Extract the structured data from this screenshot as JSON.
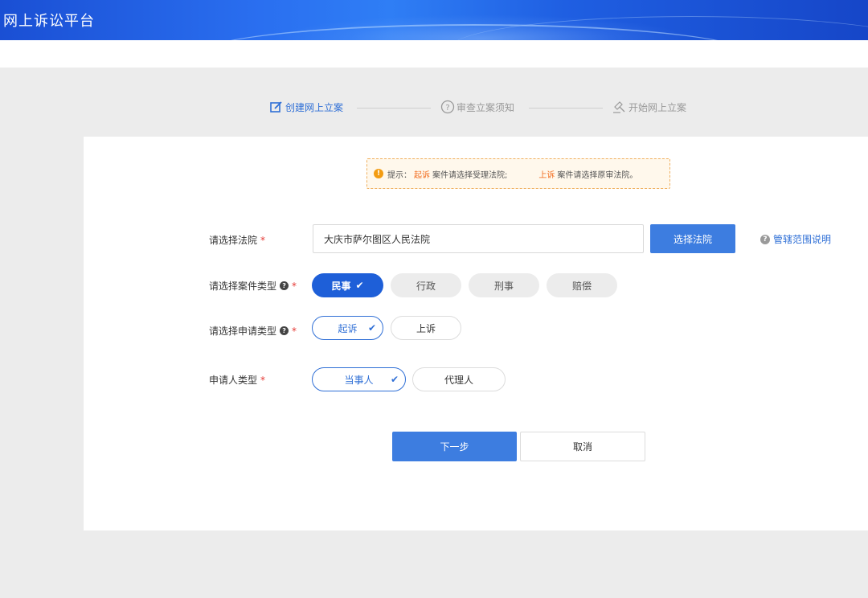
{
  "header": {
    "title": "网上诉讼平台"
  },
  "steps": [
    {
      "label": "创建网上立案",
      "icon": "edit-icon",
      "active": true
    },
    {
      "label": "审查立案须知",
      "icon": "question-circle-icon",
      "active": false
    },
    {
      "label": "开始网上立案",
      "icon": "gavel-icon",
      "active": false
    }
  ],
  "tip": {
    "prefix": "提示：",
    "part1_highlight": "起诉",
    "part1_text": "案件请选择受理法院;",
    "part2_highlight": "上诉",
    "part2_text": "案件请选择原审法院。"
  },
  "court": {
    "label": "请选择法院",
    "value": "大庆市萨尔图区人民法院",
    "button": "选择法院",
    "scope_link": "管辖范围说明"
  },
  "case_type": {
    "label": "请选择案件类型",
    "options": [
      "民事",
      "行政",
      "刑事",
      "赔偿"
    ],
    "selected": "民事"
  },
  "apply_type": {
    "label": "请选择申请类型",
    "options": [
      "起诉",
      "上诉"
    ],
    "selected": "起诉"
  },
  "applicant_type": {
    "label": "申请人类型",
    "options": [
      "当事人",
      "代理人"
    ],
    "selected": "当事人"
  },
  "actions": {
    "next": "下一步",
    "cancel": "取消"
  },
  "colors": {
    "primary": "#3d7de0",
    "accent": "#1e5fd8",
    "required": "#e53935",
    "highlight": "#f26a1b"
  }
}
